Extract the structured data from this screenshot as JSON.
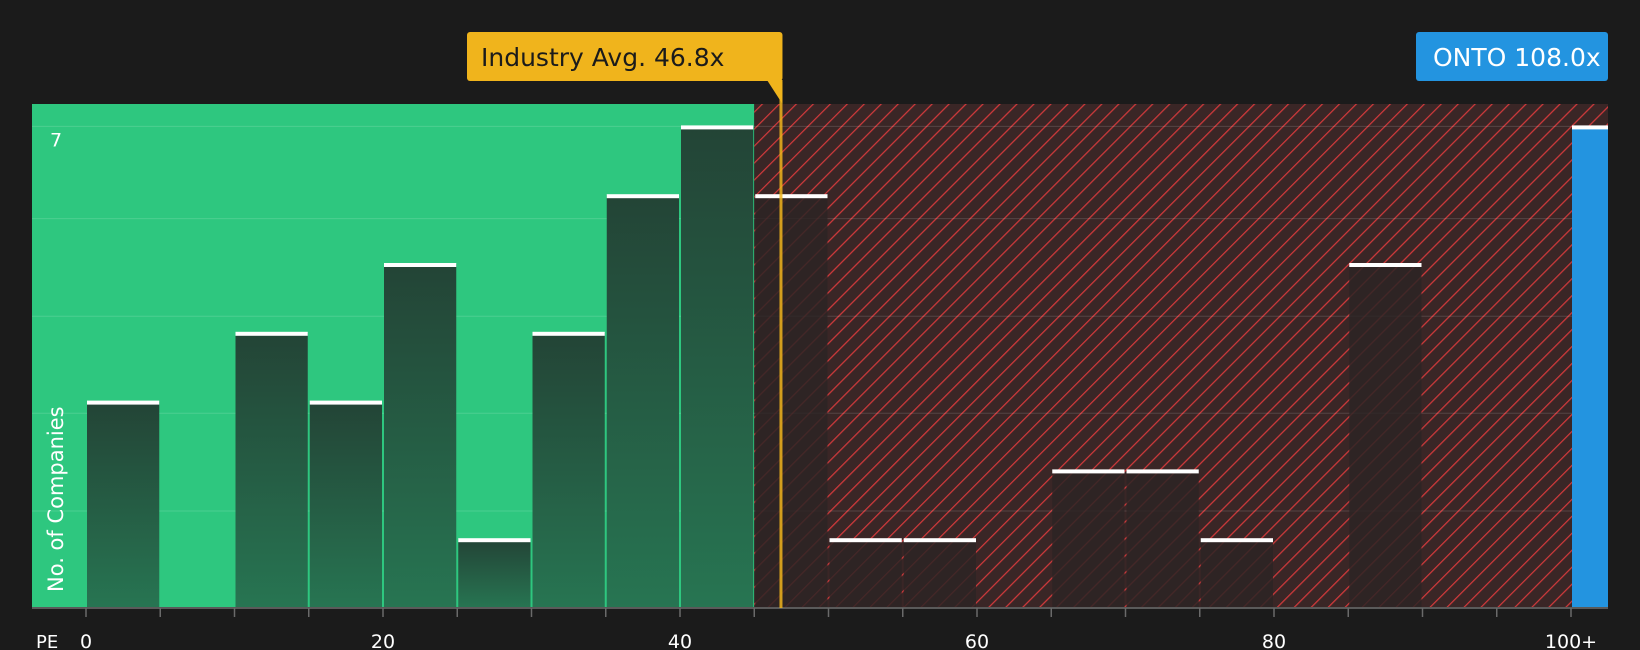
{
  "chart_data": {
    "type": "bar",
    "xlabel": "PE",
    "ylabel": "No. of Companies",
    "xlim": [
      0,
      102.5
    ],
    "ylim": [
      0,
      7.25
    ],
    "bin_width": 5,
    "x_ticks": [
      {
        "value": 0,
        "label": "0"
      },
      {
        "value": 20,
        "label": "20"
      },
      {
        "value": 40,
        "label": "40"
      },
      {
        "value": 60,
        "label": "60"
      },
      {
        "value": 80,
        "label": "80"
      },
      {
        "value": 100,
        "label": "100+"
      }
    ],
    "y_ticks": [
      {
        "value": 7,
        "label": "7"
      }
    ],
    "bins": [
      {
        "start": 0,
        "count": 3
      },
      {
        "start": 5,
        "count": 0
      },
      {
        "start": 10,
        "count": 4
      },
      {
        "start": 15,
        "count": 3
      },
      {
        "start": 20,
        "count": 5
      },
      {
        "start": 25,
        "count": 1
      },
      {
        "start": 30,
        "count": 4
      },
      {
        "start": 35,
        "count": 6
      },
      {
        "start": 40,
        "count": 7
      },
      {
        "start": 45,
        "count": 6
      },
      {
        "start": 50,
        "count": 1
      },
      {
        "start": 55,
        "count": 1
      },
      {
        "start": 60,
        "count": 0
      },
      {
        "start": 65,
        "count": 2
      },
      {
        "start": 70,
        "count": 2
      },
      {
        "start": 75,
        "count": 1
      },
      {
        "start": 80,
        "count": 0
      },
      {
        "start": 85,
        "count": 5
      },
      {
        "start": 90,
        "count": 0
      },
      {
        "start": 95,
        "count": 0
      },
      {
        "start": 100,
        "count": 7,
        "highlight": true
      }
    ],
    "industry_avg": {
      "value": 46.8,
      "label": "Industry Avg. 46.8x"
    },
    "company": {
      "value": 108.0,
      "label": "ONTO 108.0x"
    },
    "fair_region_end": 45,
    "colors": {
      "background": "#1b1b1b",
      "fair_region": "#2ec77f",
      "expensive_region": "#3a2626",
      "hatch": "#d0393b",
      "bar_green_top": "#234436",
      "bar_green_bottom": "#277552",
      "bar_dark": "#2d2525",
      "company": "#2394e0",
      "industry_avg": "#f0b41c",
      "text": "#ffffff"
    }
  }
}
